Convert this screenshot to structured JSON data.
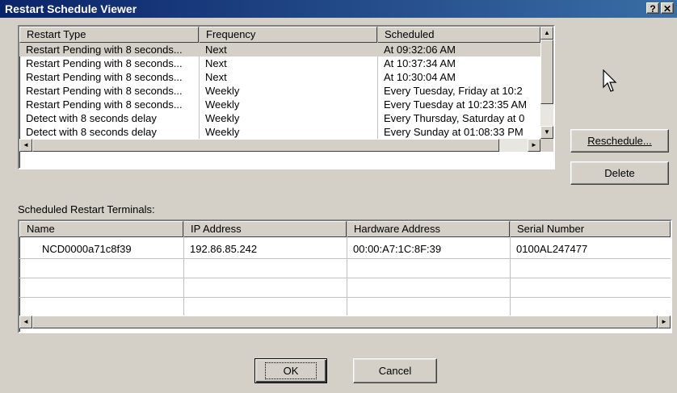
{
  "window": {
    "title": "Restart Schedule Viewer",
    "help_label": "?",
    "close_label": "✕"
  },
  "restart_list": {
    "columns": [
      "Restart Type",
      "Frequency",
      "Scheduled"
    ],
    "rows": [
      {
        "type": "Restart Pending with 8 seconds...",
        "frequency": "Next",
        "scheduled": "At 09:32:06 AM"
      },
      {
        "type": "Restart Pending with 8 seconds...",
        "frequency": "Next",
        "scheduled": "At 10:37:34 AM"
      },
      {
        "type": "Restart Pending with 8 seconds...",
        "frequency": "Next",
        "scheduled": "At 10:30:04 AM"
      },
      {
        "type": "Restart Pending with 8 seconds...",
        "frequency": "Weekly",
        "scheduled": "Every Tuesday, Friday at 10:2"
      },
      {
        "type": "Restart Pending with 8 seconds...",
        "frequency": "Weekly",
        "scheduled": "Every Tuesday at 10:23:35 AM"
      },
      {
        "type": "Detect with 8 seconds delay",
        "frequency": "Weekly",
        "scheduled": "Every Thursday, Saturday at 0"
      },
      {
        "type": "Detect with 8 seconds delay",
        "frequency": "Weekly",
        "scheduled": "Every Sunday at 01:08:33 PM"
      }
    ]
  },
  "buttons": {
    "reschedule": "Reschedule...",
    "delete": "Delete",
    "ok": "OK",
    "cancel": "Cancel"
  },
  "terminals": {
    "label": "Scheduled Restart Terminals:",
    "columns": [
      "Name",
      "IP Address",
      "Hardware Address",
      "Serial Number"
    ],
    "rows": [
      {
        "name": "NCD0000a71c8f39",
        "ip": "192.86.85.242",
        "hw": "00:00:A7:1C:8F:39",
        "serial": "0100AL247477"
      }
    ]
  },
  "icons": {
    "arrow_up": "▲",
    "arrow_down": "▼",
    "arrow_left": "◄",
    "arrow_right": "►",
    "cursor": "mouse-pointer-icon"
  }
}
